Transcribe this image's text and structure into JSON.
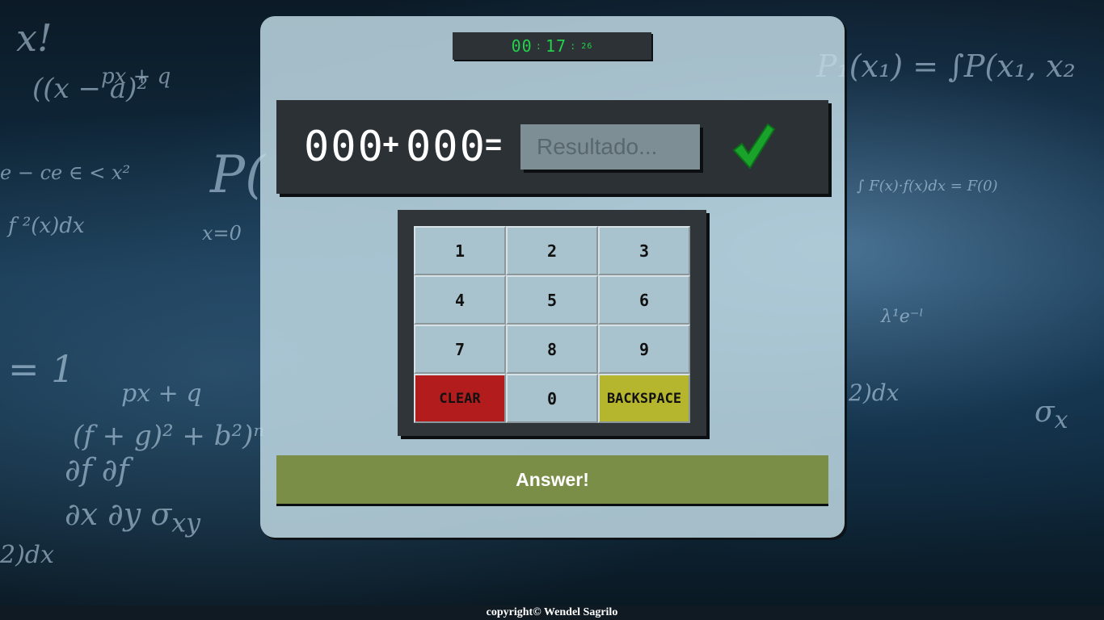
{
  "timer": {
    "minutes": "00",
    "seconds": "17",
    "centiseconds": "26",
    "separator": ":"
  },
  "equation": {
    "operand_a": "000",
    "operator": "+",
    "operand_b": "000",
    "equals": "=",
    "result_placeholder": "Resultado...",
    "result_value": "",
    "status_icon": "check-icon",
    "status_color": "#1aa32a"
  },
  "keypad": {
    "keys": [
      "1",
      "2",
      "3",
      "4",
      "5",
      "6",
      "7",
      "8",
      "9",
      "CLEAR",
      "0",
      "BACKSPACE"
    ],
    "clear_color": "#b21c1c",
    "backspace_color": "#b6b62e"
  },
  "answer_button": {
    "label": "Answer!",
    "color": "#7b8e48"
  },
  "footer": {
    "text": "copyright© Wendel Sagrilo"
  }
}
